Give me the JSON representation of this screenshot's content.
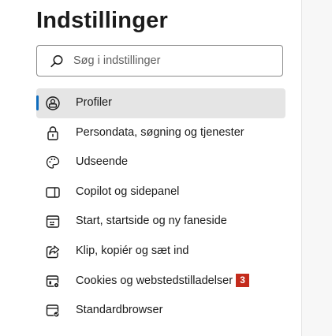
{
  "header": {
    "title": "Indstillinger"
  },
  "search": {
    "placeholder": "Søg i indstillinger",
    "value": ""
  },
  "nav": {
    "items": [
      {
        "label": "Profiler",
        "icon": "profile-icon",
        "active": true
      },
      {
        "label": "Persondata, søgning og tjenester",
        "icon": "lock-icon",
        "active": false
      },
      {
        "label": "Udseende",
        "icon": "palette-icon",
        "active": false
      },
      {
        "label": "Copilot og sidepanel",
        "icon": "sidepanel-icon",
        "active": false
      },
      {
        "label": "Start, startside og ny faneside",
        "icon": "home-window-icon",
        "active": false
      },
      {
        "label": "Klip, kopiér og sæt ind",
        "icon": "share-icon",
        "active": false
      },
      {
        "label": "Cookies og webstedstilladelser",
        "icon": "site-permissions-icon",
        "active": false,
        "badge": "3"
      },
      {
        "label": "Standardbrowser",
        "icon": "default-browser-icon",
        "active": false
      }
    ]
  },
  "colors": {
    "accent": "#0f6cbd",
    "badge": "#c42b1c",
    "active_bg": "#e5e5e5"
  }
}
